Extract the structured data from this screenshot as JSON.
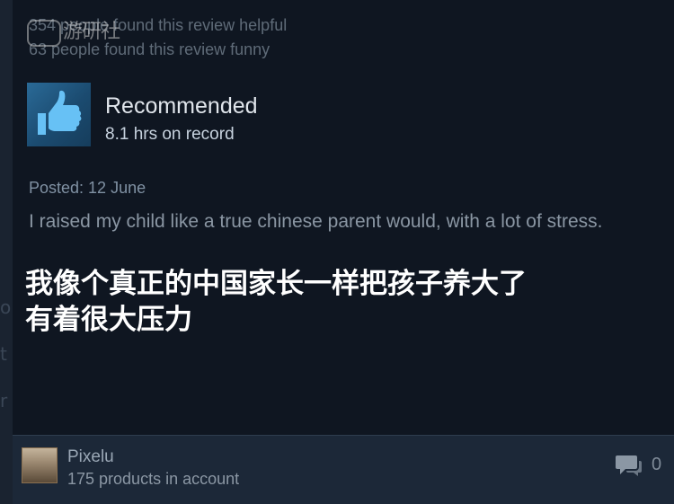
{
  "review": {
    "helpful_text": "354 people found this review helpful",
    "funny_text": "63 people found this review funny",
    "verdict": "Recommended",
    "playtime": "8.1 hrs on record",
    "posted": "Posted: 12 June",
    "body": "I raised my child like a true chinese parent would, with a lot of stress.",
    "caption_line1": "我像个真正的中国家长一样把孩子养大了",
    "caption_line2": "有着很大压力",
    "thumb_icon": "thumbs-up-icon"
  },
  "author": {
    "name": "Pixelu",
    "products": "175 products in account"
  },
  "comments": {
    "icon": "comment-icon",
    "count": "0"
  },
  "watermark": {
    "text": "游研社"
  },
  "colors": {
    "background": "#0f1621",
    "footer": "#1c2838",
    "thumb_tile": "#1b4b70",
    "thumb_fill": "#67c1f5"
  }
}
